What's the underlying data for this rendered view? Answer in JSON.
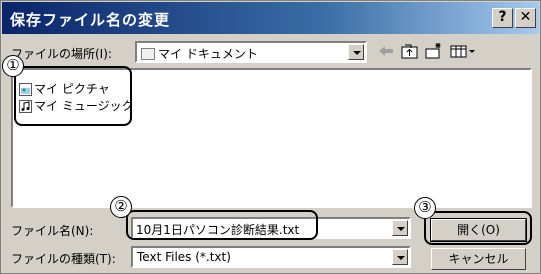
{
  "window": {
    "title": "保存ファイル名の変更",
    "help_label": "?",
    "close_label": "✕"
  },
  "location": {
    "label": "ファイルの場所(I):",
    "value": "マイ ドキュメント"
  },
  "files": [
    {
      "name": "マイ ピクチャ",
      "icon": "pictures-folder-icon"
    },
    {
      "name": "マイ ミュージック",
      "icon": "music-folder-icon"
    }
  ],
  "filename": {
    "label": "ファイル名(N):",
    "value": "10月1日パソコン診断結果.txt"
  },
  "filetype": {
    "label": "ファイルの種類(T):",
    "value": "Text Files (*.txt)"
  },
  "buttons": {
    "open": "開く(O)",
    "cancel": "キャンセル"
  },
  "callouts": [
    "①",
    "②",
    "③"
  ]
}
